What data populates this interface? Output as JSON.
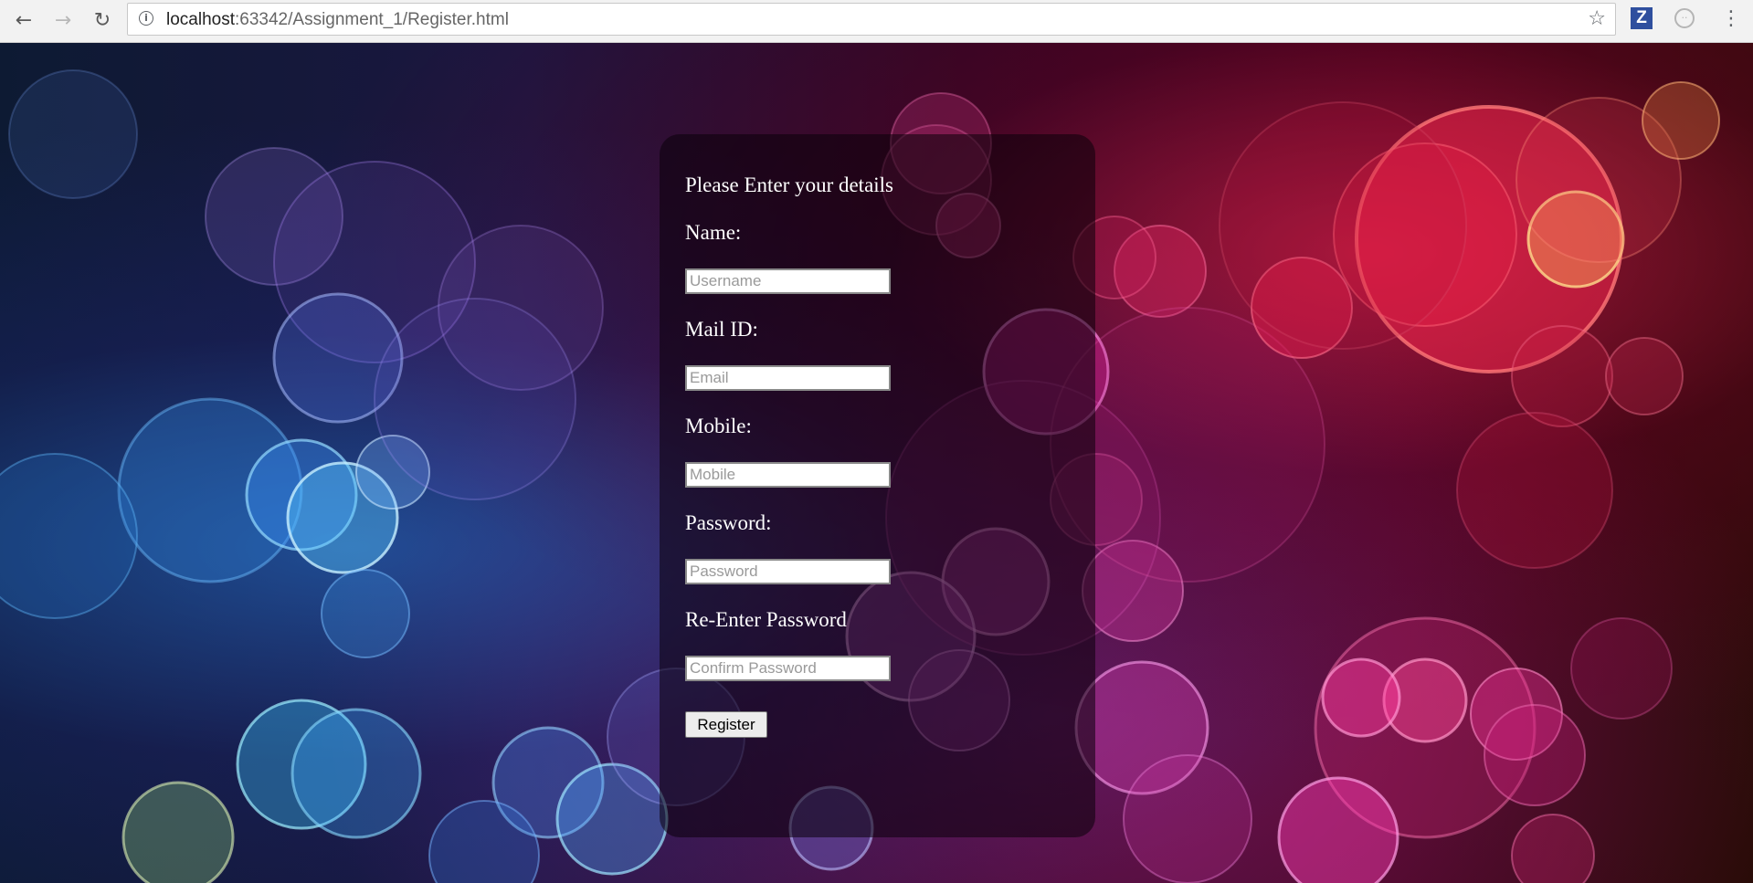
{
  "browser": {
    "url_host": "localhost",
    "url_path": ":63342/Assignment_1/Register.html",
    "back_icon": "arrow-left-icon",
    "forward_icon": "arrow-right-icon",
    "reload_icon": "reload-icon",
    "info_icon": "info-icon",
    "star_icon": "star-icon",
    "extension_z_label": "Z",
    "extension_circle_icon": "extension-icon",
    "menu_icon": "more-vert-icon"
  },
  "form": {
    "title": "Please Enter your details",
    "fields": [
      {
        "label": "Name:",
        "placeholder": "Username",
        "value": ""
      },
      {
        "label": "Mail ID:",
        "placeholder": "Email",
        "value": ""
      },
      {
        "label": "Mobile:",
        "placeholder": "Mobile",
        "value": ""
      },
      {
        "label": "Password:",
        "placeholder": "Password",
        "value": ""
      },
      {
        "label": "Re-Enter Password",
        "placeholder": "Confirm Password",
        "value": ""
      }
    ],
    "submit_label": "Register"
  },
  "colors": {
    "panel_bg": "#0a000a",
    "label_text": "#ffffff",
    "input_border": "#8a8a8a",
    "button_bg": "#ececec"
  }
}
